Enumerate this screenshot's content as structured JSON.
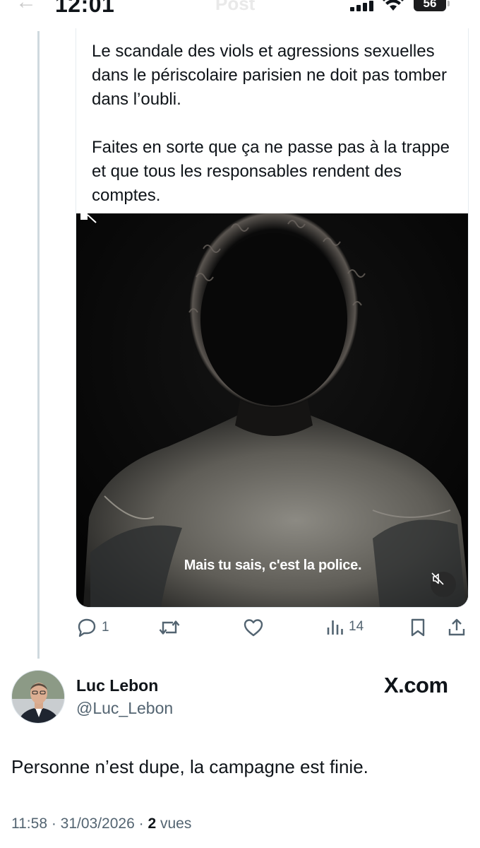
{
  "status_bar": {
    "time": "12:01",
    "title": "Post",
    "battery": "56"
  },
  "quoted_post": {
    "paragraphs": [
      "Le scandale des viols et agressions sexuelles dans le périscolaire parisien ne doit pas tomber dans l’oubli.",
      "Faites en sorte que ça ne passe pas à la trappe et que tous les responsables rendent des comptes."
    ],
    "video": {
      "caption": "Mais tu sais, c'est la police.",
      "muted": true
    }
  },
  "actions": {
    "replies": "1",
    "views": "14"
  },
  "author": {
    "name": "Luc Lebon",
    "handle": "@Luc_Lebon"
  },
  "brand": {
    "logo_text": "X.com"
  },
  "post": {
    "text": "Personne n’est dupe, la campagne est finie.",
    "time": "11:58",
    "date": "31/03/2026",
    "views_count": "2",
    "views_label": "vues"
  },
  "colors": {
    "text": "#0f1419",
    "secondary": "#536471",
    "border": "#cfd9de"
  }
}
